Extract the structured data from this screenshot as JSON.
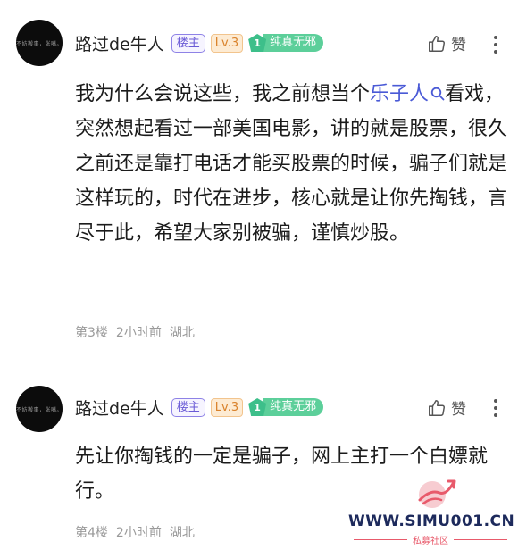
{
  "comments": [
    {
      "avatar_text": "不妨搬事，张嘴。",
      "username": "路过de牛人",
      "owner_badge": "楼主",
      "level": "Lv.3",
      "title_rank": "1",
      "title": "纯真无邪",
      "like_label": "赞",
      "content_before_link": "我为什么会说这些，我之前想当个",
      "link_text": "乐子人",
      "content_after_link": "看戏，突然想起看过一部美国电影，讲的就是股票，很久之前还是靠打电话才能买股票的时候，骗子们就是这样玩的，时代在进步，核心就是让你先掏钱，言尽于此，希望大家别被骗，谨慎炒股。",
      "floor": "第3楼",
      "time": "2小时前",
      "location": "湖北"
    },
    {
      "avatar_text": "不妨搬事，张嘴。",
      "username": "路过de牛人",
      "owner_badge": "楼主",
      "level": "Lv.3",
      "title_rank": "1",
      "title": "纯真无邪",
      "like_label": "赞",
      "content": "先让你掏钱的一定是骗子，网上主打一个白嫖就行。",
      "floor": "第4楼",
      "time": "2小时前",
      "location": "湖北"
    }
  ],
  "watermark": {
    "url": "WWW.SIMU001.CN",
    "subtitle": "私募社区"
  },
  "colors": {
    "link": "#4a5ad6",
    "owner_badge": "#6a5ad6",
    "level_badge": "#d9822b",
    "title_badge": "#5ccf9a",
    "meta_text": "#9a9a9a"
  },
  "icons": [
    "thumbs-up-icon",
    "more-vertical-icon",
    "search-icon",
    "gem-icon"
  ]
}
